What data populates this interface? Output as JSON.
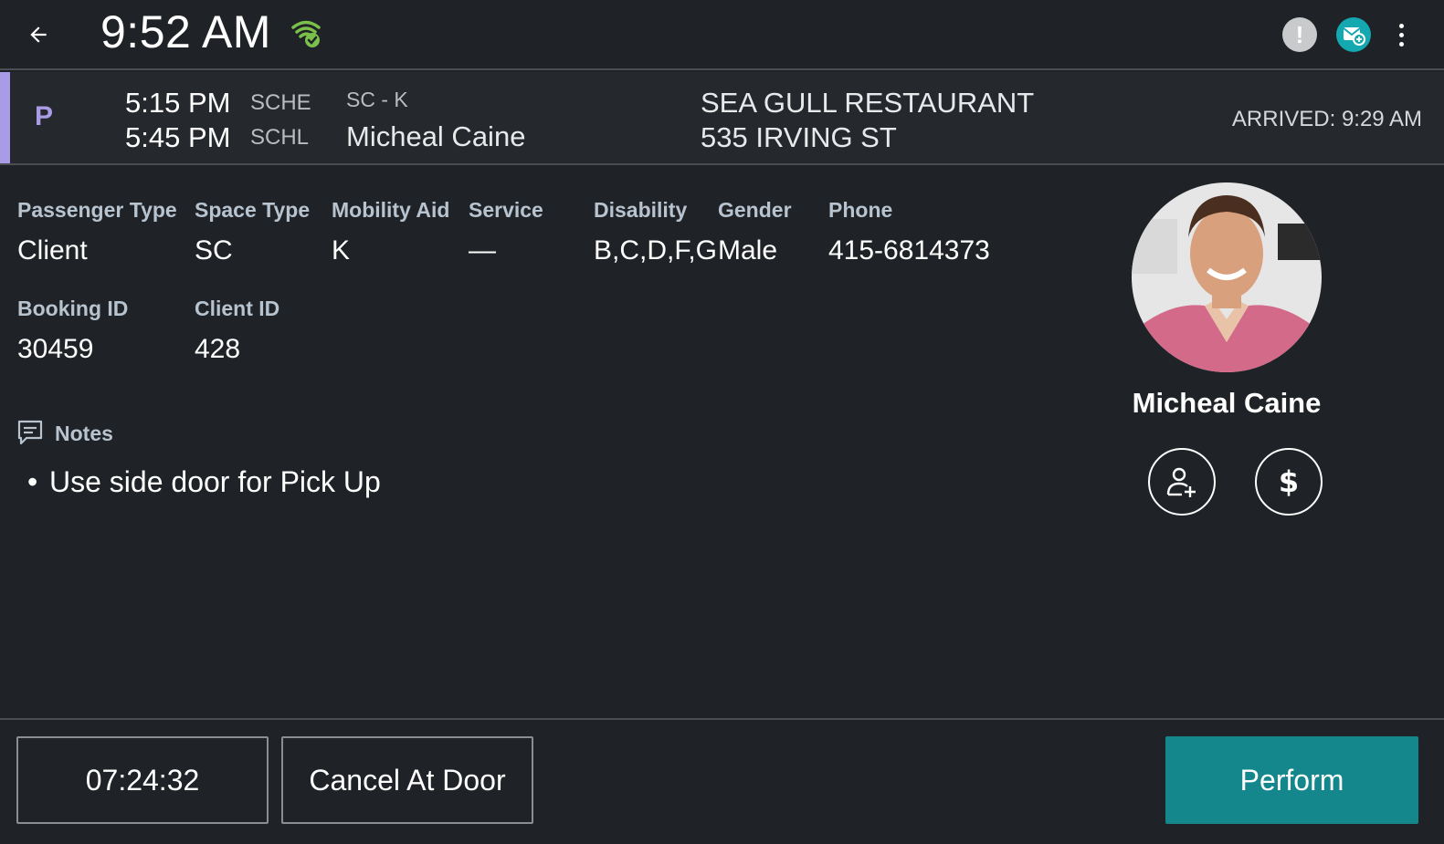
{
  "topbar": {
    "time": "9:52 AM",
    "icons": [
      "back-arrow-icon",
      "wifi-check-icon",
      "alert-icon",
      "message-icon",
      "more-vert-icon"
    ],
    "alert_symbol": "!"
  },
  "trip": {
    "type_letter": "P",
    "times": [
      "5:15 PM",
      "5:45 PM"
    ],
    "codes": [
      "SCHE",
      "SCHL"
    ],
    "service_code": "SC - K",
    "passenger_name": "Micheal Caine",
    "address_line1": "SEA GULL RESTAURANT",
    "address_line2": "535 IRVING ST",
    "arrived": "ARRIVED: 9:29 AM",
    "accent_color": "#a99be6"
  },
  "details": {
    "passenger_type": {
      "label": "Passenger Type",
      "value": "Client"
    },
    "space_type": {
      "label": "Space Type",
      "value": "SC"
    },
    "mobility_aid": {
      "label": "Mobility Aid",
      "value": "K"
    },
    "service": {
      "label": "Service",
      "value": "—"
    },
    "disability": {
      "label": "Disability",
      "value": "B,C,D,F,G"
    },
    "gender": {
      "label": "Gender",
      "value": "Male"
    },
    "phone": {
      "label": "Phone",
      "value": "415-6814373"
    },
    "booking_id": {
      "label": "Booking ID",
      "value": "30459"
    },
    "client_id": {
      "label": "Client ID",
      "value": "428"
    }
  },
  "notes": {
    "label": "Notes",
    "items": [
      "Use side door for Pick Up"
    ]
  },
  "profile": {
    "name": "Micheal Caine",
    "actions": [
      "add-person-icon",
      "dollar-icon"
    ]
  },
  "footer": {
    "timer": "07:24:32",
    "cancel_label": "Cancel At Door",
    "perform_label": "Perform",
    "perform_color": "#14878c"
  }
}
